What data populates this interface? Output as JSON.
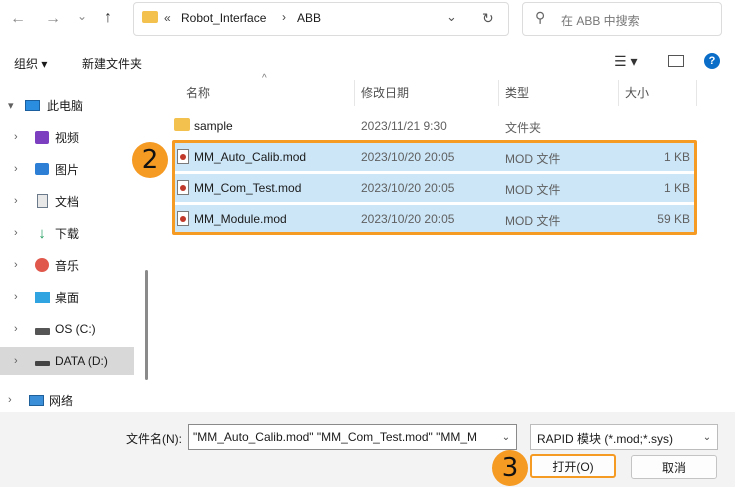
{
  "nav": {
    "back_icon": "←",
    "forward_icon": "→",
    "recent_icon": "⌄",
    "up_icon": "↑"
  },
  "address": {
    "prefix": "«",
    "crumb1": "Robot_Interface",
    "separator": "›",
    "crumb2": "ABB"
  },
  "search": {
    "placeholder": "在 ABB 中搜索"
  },
  "toolbar": {
    "organize": "组织 ▾",
    "new_folder": "新建文件夹",
    "help": "?"
  },
  "sidebar": {
    "items": [
      {
        "label": "此电脑",
        "chevron": "▾",
        "icon": "pc-icon"
      },
      {
        "label": "视频",
        "chevron": "›",
        "icon": "video-icon"
      },
      {
        "label": "图片",
        "chevron": "›",
        "icon": "pictures-icon"
      },
      {
        "label": "文档",
        "chevron": "›",
        "icon": "documents-icon"
      },
      {
        "label": "下载",
        "chevron": "›",
        "icon": "download-icon"
      },
      {
        "label": "音乐",
        "chevron": "›",
        "icon": "music-icon"
      },
      {
        "label": "桌面",
        "chevron": "›",
        "icon": "desktop-icon"
      },
      {
        "label": "OS (C:)",
        "chevron": "›",
        "icon": "drive-c-icon"
      },
      {
        "label": "DATA (D:)",
        "chevron": "›",
        "icon": "drive-d-icon"
      },
      {
        "label": "网络",
        "chevron": "›",
        "icon": "network-icon"
      }
    ]
  },
  "columns": {
    "name": "名称",
    "date": "修改日期",
    "type": "类型",
    "size": "大小",
    "sort_indicator": "^"
  },
  "files": [
    {
      "name": "sample",
      "date": "2023/11/21 9:30",
      "type": "文件夹",
      "size": "",
      "kind": "folder",
      "selected": false
    },
    {
      "name": "MM_Auto_Calib.mod",
      "date": "2023/10/20 20:05",
      "type": "MOD 文件",
      "size": "1 KB",
      "kind": "file",
      "selected": true
    },
    {
      "name": "MM_Com_Test.mod",
      "date": "2023/10/20 20:05",
      "type": "MOD 文件",
      "size": "1 KB",
      "kind": "file",
      "selected": true
    },
    {
      "name": "MM_Module.mod",
      "date": "2023/10/20 20:05",
      "type": "MOD 文件",
      "size": "59 KB",
      "kind": "file",
      "selected": true
    }
  ],
  "annotations": {
    "step2": "2",
    "step3": "3"
  },
  "bottom": {
    "filename_label": "文件名(N):",
    "filename_value": "\"MM_Auto_Calib.mod\" \"MM_Com_Test.mod\" \"MM_M",
    "filter_value": "RAPID 模块 (*.mod;*.sys)",
    "open_label": "打开(O)",
    "cancel_label": "取消"
  },
  "colors": {
    "accent": "#f59a23",
    "selection": "#cce6f7",
    "help": "#0a6ec8"
  }
}
